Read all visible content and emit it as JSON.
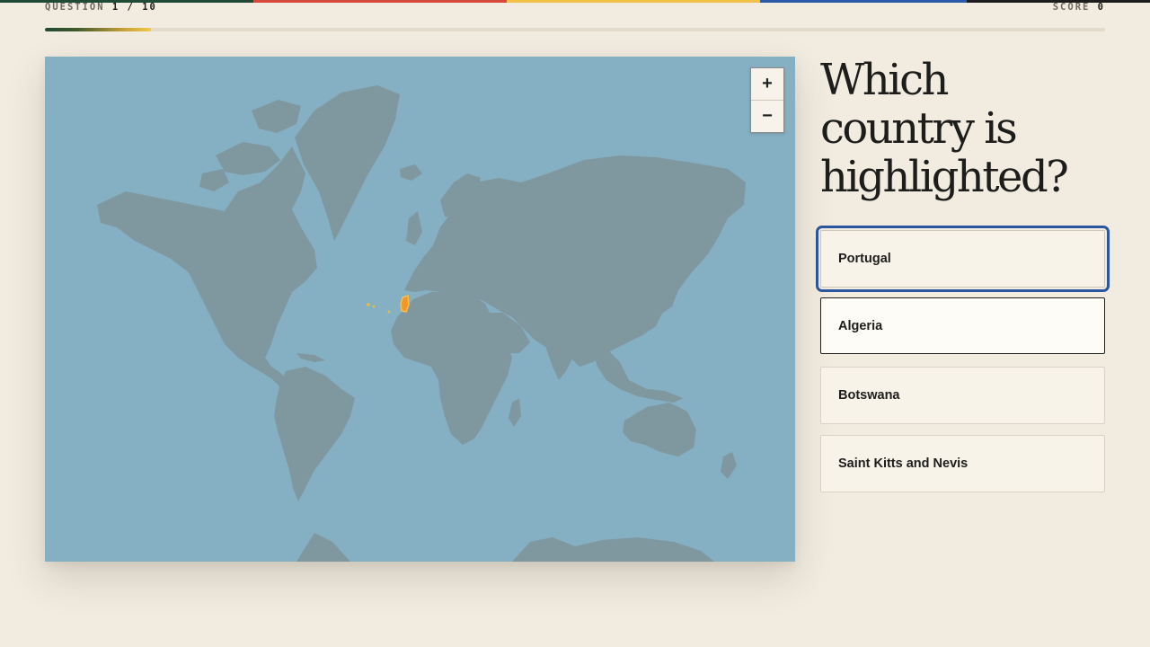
{
  "hud": {
    "question_label": "QUESTION",
    "question_counter": "1 / 10",
    "score_label": "SCORE",
    "score_value": "0"
  },
  "progress": {
    "fraction": 0.1
  },
  "colors": {
    "stripe": [
      "#1f4a36",
      "#d8473b",
      "#f1c14a",
      "#2a5aa8",
      "#1d1d1b"
    ],
    "ocean": "#85afc2",
    "land": "#7f979f",
    "highlight": "#f0962f",
    "focus": "#2a56a0"
  },
  "map": {
    "zoom_in_label": "+",
    "zoom_out_label": "−"
  },
  "question": {
    "text": "Which country is highlighted?"
  },
  "answers": [
    {
      "label": "Portugal",
      "state": "focused"
    },
    {
      "label": "Algeria",
      "state": "hover"
    },
    {
      "label": "Botswana",
      "state": "default"
    },
    {
      "label": "Saint Kitts and Nevis",
      "state": "default"
    }
  ]
}
